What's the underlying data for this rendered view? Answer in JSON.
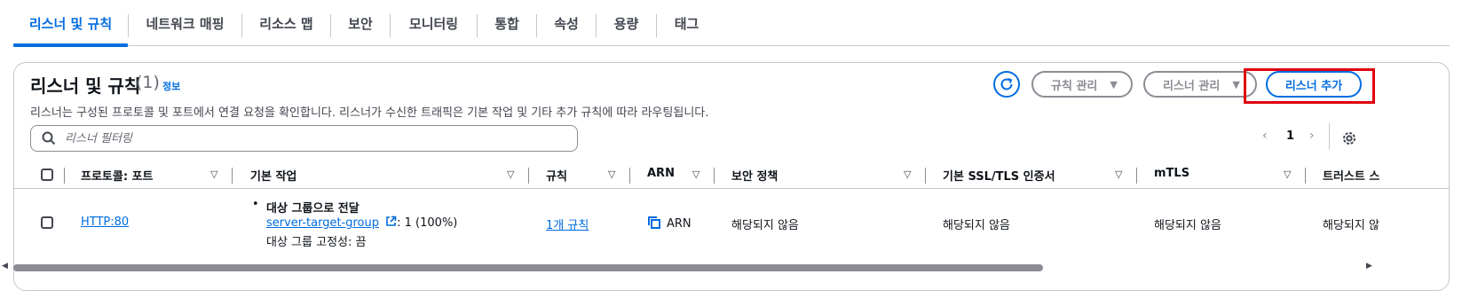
{
  "tabs": [
    {
      "label": "리스너 및 규칙",
      "active": true
    },
    {
      "label": "네트워크 매핑",
      "active": false
    },
    {
      "label": "리소스 맵",
      "active": false
    },
    {
      "label": "보안",
      "active": false
    },
    {
      "label": "모니터링",
      "active": false
    },
    {
      "label": "통합",
      "active": false
    },
    {
      "label": "속성",
      "active": false
    },
    {
      "label": "용량",
      "active": false
    },
    {
      "label": "태그",
      "active": false
    }
  ],
  "panel": {
    "title": "리스너 및 규칙",
    "count": "(1)",
    "info": "정보",
    "description": "리스너는 구성된 프로토콜 및 포트에서 연결 요청을 확인합니다. 리스너가 수신한 트래픽은 기본 작업 및 기타 추가 규칙에 따라 라우팅됩니다.",
    "buttons": {
      "manage_rules": "규칙 관리",
      "manage_listeners": "리스너 관리",
      "add_listener": "리스너 추가"
    },
    "filter_placeholder": "리스너 필터링",
    "page_number": "1"
  },
  "table": {
    "columns": [
      "프로토콜: 포트",
      "기본 작업",
      "규칙",
      "ARN",
      "보안 정책",
      "기본 SSL/TLS 인증서",
      "mTLS",
      "트러스트 스"
    ],
    "row": {
      "protocol_port": "HTTP:80",
      "action_title": "대상 그룹으로 전달",
      "target_group": "server-target-group",
      "weight": ": 1 (100%)",
      "stickiness": "대상 그룹 고정성: 끔",
      "rules": "1개 규칙",
      "arn": "ARN",
      "security_policy": "해당되지 않음",
      "ssl_cert": "해당되지 않음",
      "mtls": "해당되지 않음",
      "trust_store": "해당되지 않"
    }
  },
  "colors": {
    "accent": "#006ce0",
    "highlight": "#e0000f",
    "text": "#0f141a",
    "muted": "#424650"
  }
}
